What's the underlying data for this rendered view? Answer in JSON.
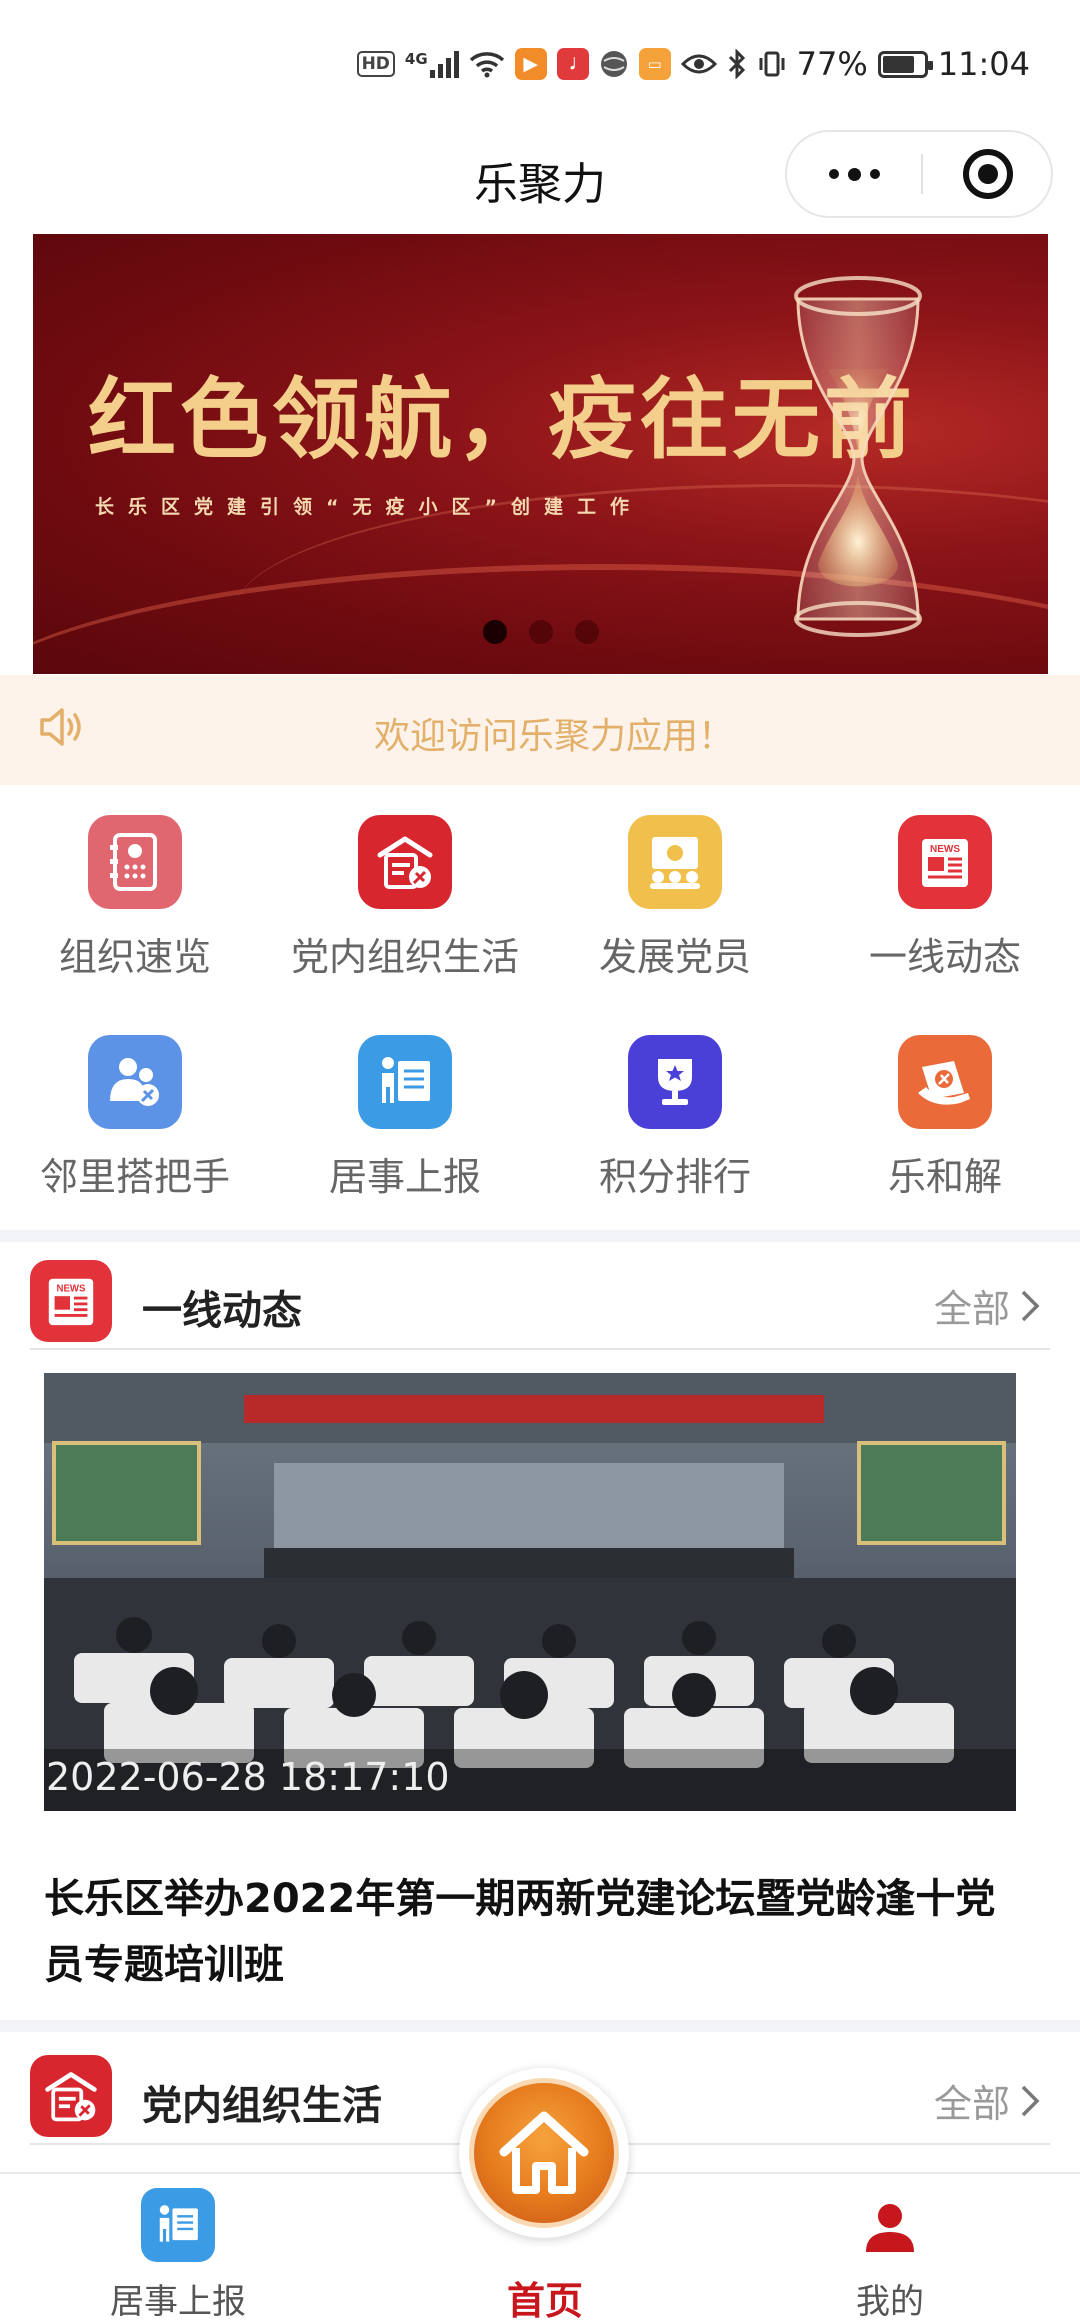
{
  "status_bar": {
    "hd": "HD",
    "network": "4G",
    "battery": "77%",
    "time": "11:04"
  },
  "header": {
    "title": "乐聚力"
  },
  "banner": {
    "headline": "红色领航，疫往无前",
    "subtitle": "长乐区党建引领“无疫小区”创建工作",
    "slide_count": 3,
    "active_slide": 1
  },
  "notice": {
    "text": "欢迎访问乐聚力应用！"
  },
  "grid": {
    "items": [
      {
        "label": "组织速览",
        "icon": "org-book-icon",
        "color": "#e0666f"
      },
      {
        "label": "党内组织生活",
        "icon": "party-building-icon",
        "color": "#d8262e"
      },
      {
        "label": "发展党员",
        "icon": "meeting-icon",
        "color": "#f1c04c"
      },
      {
        "label": "一线动态",
        "icon": "news-icon",
        "color": "#e2323a"
      },
      {
        "label": "邻里搭把手",
        "icon": "neighbors-icon",
        "color": "#5d93e6"
      },
      {
        "label": "居事上报",
        "icon": "report-board-icon",
        "color": "#3b9be5"
      },
      {
        "label": "积分排行",
        "icon": "trophy-icon",
        "color": "#4a3fd6"
      },
      {
        "label": "乐和解",
        "icon": "handshake-icon",
        "color": "#ea6a3a"
      }
    ]
  },
  "section_news": {
    "title": "一线动态",
    "more": "全部",
    "item": {
      "date": "2022-06-28 18:17:10",
      "title": "长乐区举办2022年第一期两新党建论坛暨党龄逢十党员专题培训班"
    }
  },
  "section_party": {
    "title": "党内组织生活",
    "more": "全部"
  },
  "tabbar": {
    "left": "居事上报",
    "center": "首页",
    "right": "我的"
  },
  "colors": {
    "primary_red": "#c8161d",
    "notice_text": "#e3b06a",
    "notice_bg": "#fdf3ea"
  }
}
